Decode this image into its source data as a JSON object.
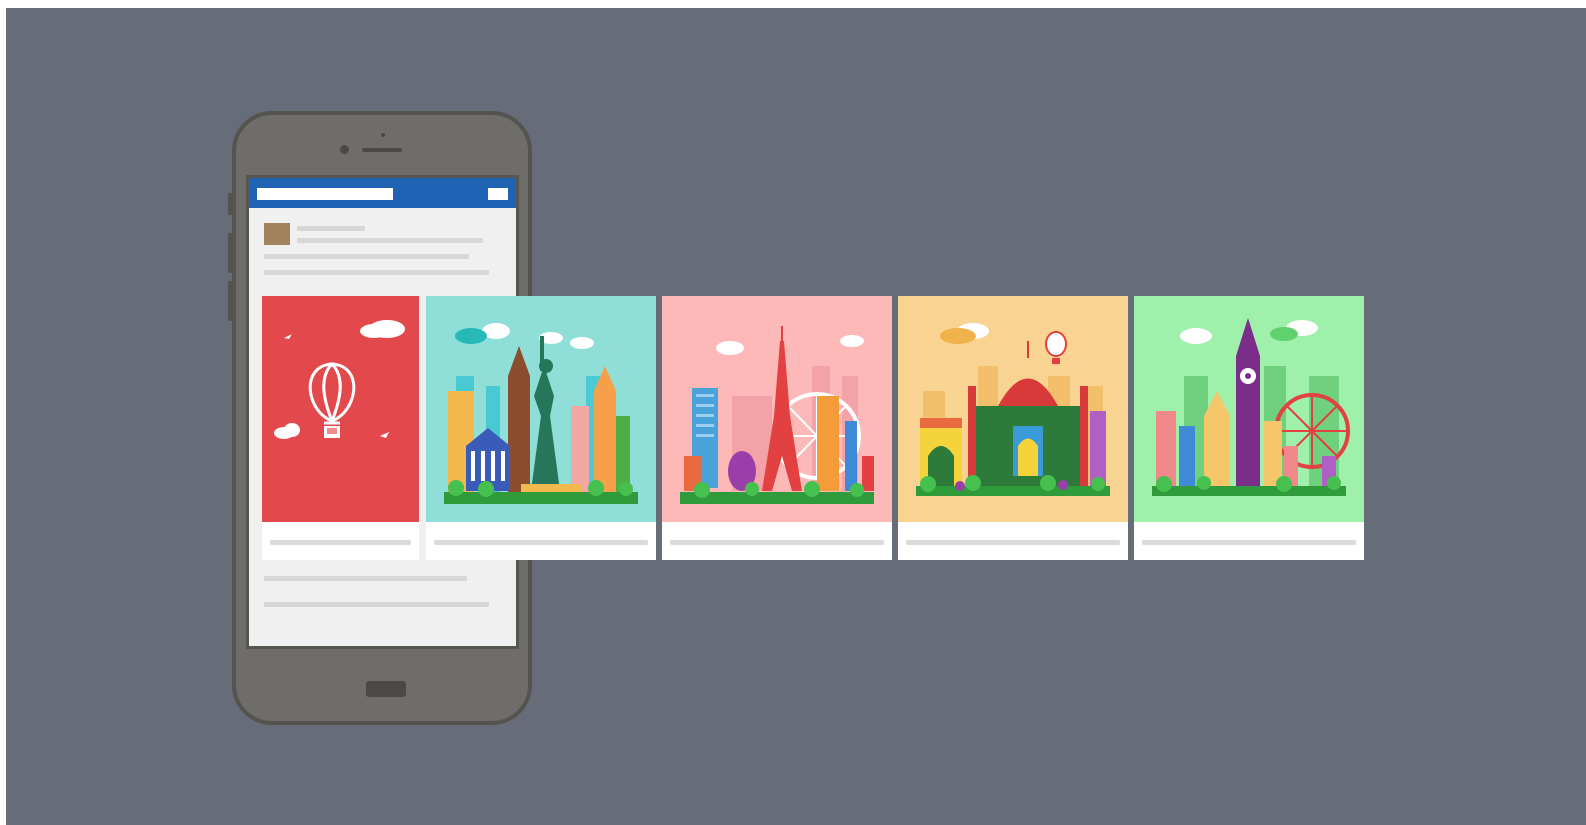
{
  "colors": {
    "background": "#666c78",
    "phone_body": "#6e6d69",
    "header_bar": "#1f63b5",
    "card_red": "#e3484c",
    "card_teal": "#8fdfd8",
    "card_pink": "#fcb9b7",
    "card_orange": "#f9d392",
    "card_green": "#9ff0aa"
  },
  "carousel": {
    "cards": [
      {
        "theme": "hot-air-balloon-icon",
        "bg": "#e3484c"
      },
      {
        "theme": "new-york-skyline-icon",
        "bg": "#8fdfd8"
      },
      {
        "theme": "paris-skyline-icon",
        "bg": "#fcb9b7"
      },
      {
        "theme": "india-skyline-icon",
        "bg": "#f9d392"
      },
      {
        "theme": "london-skyline-icon",
        "bg": "#9ff0aa"
      }
    ]
  }
}
